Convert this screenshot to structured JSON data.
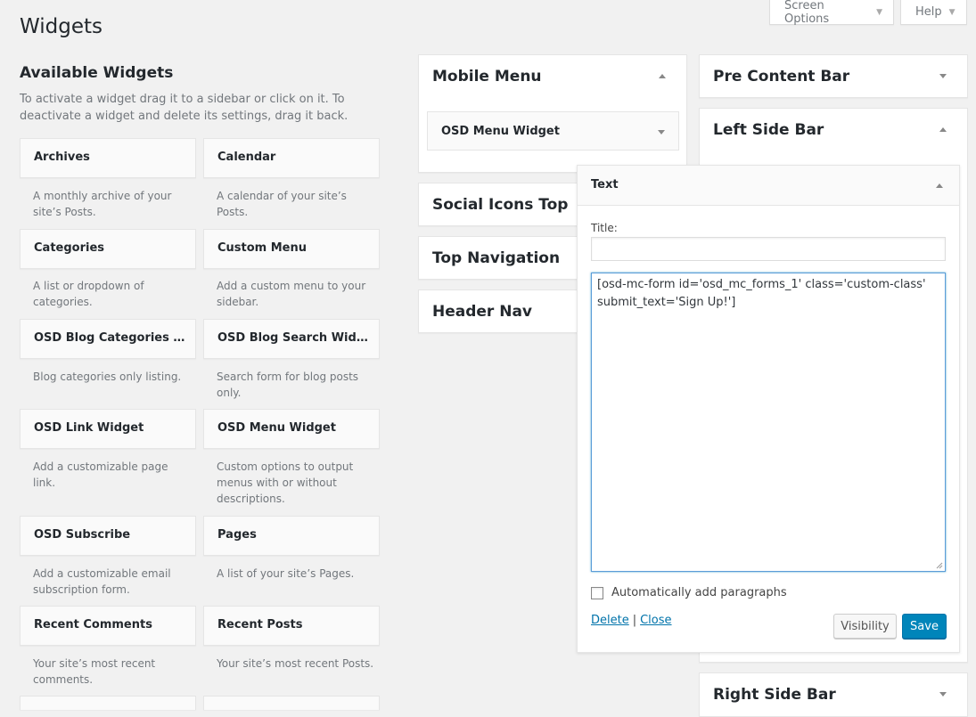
{
  "screen_meta": {
    "screen_options_label": "Screen Options",
    "help_label": "Help"
  },
  "page_title": "Widgets",
  "available": {
    "heading": "Available Widgets",
    "description": "To activate a widget drag it to a sidebar or click on it. To deactivate a widget and delete its settings, drag it back.",
    "widgets": [
      {
        "name": "Archives",
        "description": "A monthly archive of your site’s Posts."
      },
      {
        "name": "Calendar",
        "description": "A calendar of your site’s Posts."
      },
      {
        "name": "Categories",
        "description": "A list or dropdown of categories."
      },
      {
        "name": "Custom Menu",
        "description": "Add a custom menu to your sidebar."
      },
      {
        "name": "OSD Blog Categories Wid...",
        "description": "Blog categories only listing."
      },
      {
        "name": "OSD Blog Search Widget",
        "description": "Search form for blog posts only."
      },
      {
        "name": "OSD Link Widget",
        "description": "Add a customizable page link."
      },
      {
        "name": "OSD Menu Widget",
        "description": "Custom options to output menus with or without descriptions."
      },
      {
        "name": "OSD Subscribe",
        "description": "Add a customizable email subscription form."
      },
      {
        "name": "Pages",
        "description": "A list of your site’s Pages."
      },
      {
        "name": "Recent Comments",
        "description": "Your site’s most recent comments."
      },
      {
        "name": "Recent Posts",
        "description": "Your site’s most recent Posts."
      }
    ]
  },
  "sidebars_middle": [
    {
      "title": "Mobile Menu"
    },
    {
      "title": "Social Icons Top"
    },
    {
      "title": "Top Navigation"
    },
    {
      "title": "Header Nav"
    }
  ],
  "mobile_menu_widget": "OSD Menu Widget",
  "sidebars_right": [
    {
      "title": "Pre Content Bar"
    },
    {
      "title": "Left Side Bar"
    },
    {
      "title": "Right Side Bar"
    }
  ],
  "text_widget": {
    "title": "Text",
    "title_label": "Title:",
    "title_value": "",
    "content": "[osd-mc-form id='osd_mc_forms_1' class='custom-class' submit_text='Sign Up!']",
    "autop_label": "Automatically add paragraphs",
    "autop_checked": false,
    "delete_label": "Delete",
    "separator": "|",
    "close_label": "Close",
    "visibility_label": "Visibility",
    "save_label": "Save"
  },
  "colors": {
    "background": "#f1f1f1",
    "primary_button": "#0085ba",
    "link": "#0073aa",
    "focus_border": "#5b9dd9"
  }
}
